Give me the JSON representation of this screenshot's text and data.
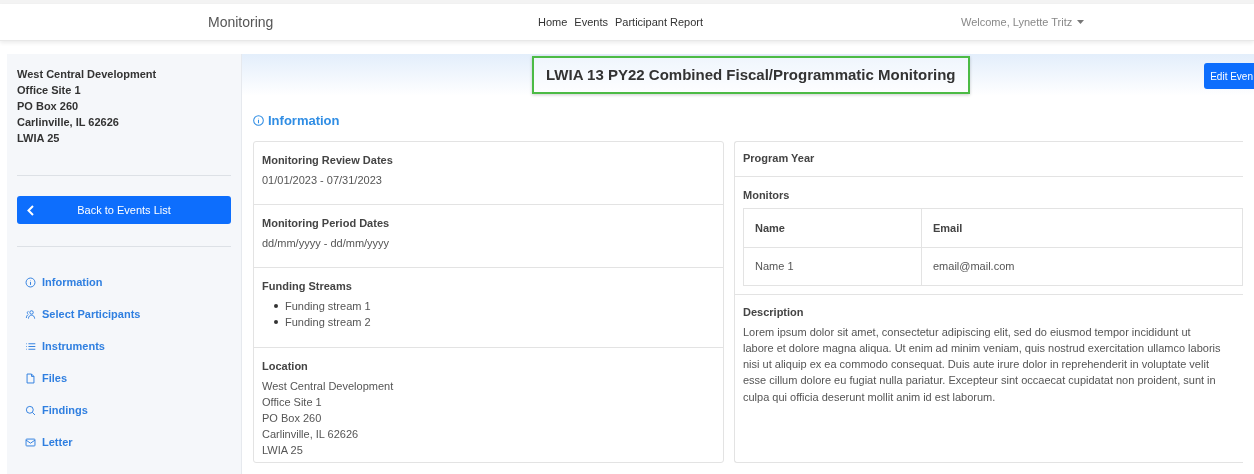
{
  "navbar": {
    "brand": "Monitoring",
    "links": [
      "Home",
      "Events",
      "Participant Report"
    ],
    "user_menu": "Welcome, Lynette Tritz"
  },
  "sidebar": {
    "address": [
      "West Central Development",
      "Office Site 1",
      "PO Box 260",
      "Carlinville, IL 62626",
      "LWIA 25"
    ],
    "back_button": "Back to Events List",
    "items": [
      {
        "label": "Information"
      },
      {
        "label": "Select Participants"
      },
      {
        "label": "Instruments"
      },
      {
        "label": "Files"
      },
      {
        "label": "Findings"
      },
      {
        "label": "Letter"
      }
    ]
  },
  "header": {
    "title": "LWIA 13 PY22 Combined Fiscal/Programmatic Monitoring",
    "edit_button": "Edit Even"
  },
  "section_title": "Information",
  "left_card": [
    {
      "kind": "text",
      "label": "Monitoring Review Dates",
      "lines": [
        "01/01/2023 - 07/31/2023"
      ]
    },
    {
      "kind": "text",
      "label": "Monitoring Period Dates",
      "lines": [
        "dd/mm/yyyy - dd/mm/yyyy"
      ]
    },
    {
      "kind": "list",
      "label": "Funding Streams",
      "lines": [
        "Funding stream 1",
        "Funding stream 2"
      ]
    },
    {
      "kind": "text",
      "label": "Location",
      "lines": [
        "West Central Development",
        "Office Site 1",
        "PO Box 260",
        "Carlinville, IL 62626",
        "LWIA 25"
      ]
    }
  ],
  "right_card": {
    "program_year_label": "Program Year",
    "monitors_label": "Monitors",
    "monitors_table": {
      "columns": [
        "Name",
        "Email"
      ],
      "rows": [
        [
          "Name 1",
          "email@mail.com"
        ]
      ]
    },
    "description_label": "Description",
    "description": "Lorem ipsum dolor sit amet, consectetur adipiscing elit, sed do eiusmod tempor incididunt ut labore et dolore magna aliqua. Ut enim ad minim veniam, quis nostrud exercitation ullamco laboris nisi ut aliquip ex ea commodo consequat. Duis aute irure dolor in reprehenderit in voluptate velit esse cillum dolore eu fugiat nulla pariatur. Excepteur sint occaecat cupidatat non proident, sunt in culpa qui officia deserunt mollit anim id est laborum."
  }
}
